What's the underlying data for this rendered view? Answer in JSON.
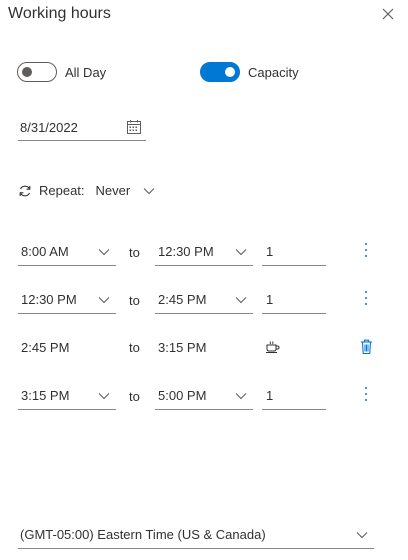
{
  "panel": {
    "title": "Working hours",
    "close_icon": "close-icon"
  },
  "toggles": {
    "all_day": {
      "label": "All Day",
      "on": false
    },
    "capacity": {
      "label": "Capacity",
      "on": true
    }
  },
  "date": {
    "value": "8/31/2022",
    "icon": "calendar-icon"
  },
  "repeat": {
    "label": "Repeat:",
    "value": "Never",
    "icon": "repeat-icon"
  },
  "rows": [
    {
      "start": "8:00 AM",
      "to": "to",
      "end": "12:30 PM",
      "capacity": "1",
      "type": "editable"
    },
    {
      "start": "12:30 PM",
      "to": "to",
      "end": "2:45 PM",
      "capacity": "1",
      "type": "editable"
    },
    {
      "start": "2:45 PM",
      "to": "to",
      "end": "3:15 PM",
      "capacity": "",
      "type": "break",
      "break_icon": "coffee-cup-icon",
      "delete_icon": "trash-icon"
    },
    {
      "start": "3:15 PM",
      "to": "to",
      "end": "5:00 PM",
      "capacity": "1",
      "type": "editable"
    }
  ],
  "timezone": {
    "value": "(GMT-05:00) Eastern Time (US & Canada)"
  },
  "colors": {
    "accent": "#0078d4",
    "text": "#323130",
    "border": "#8a8886"
  }
}
